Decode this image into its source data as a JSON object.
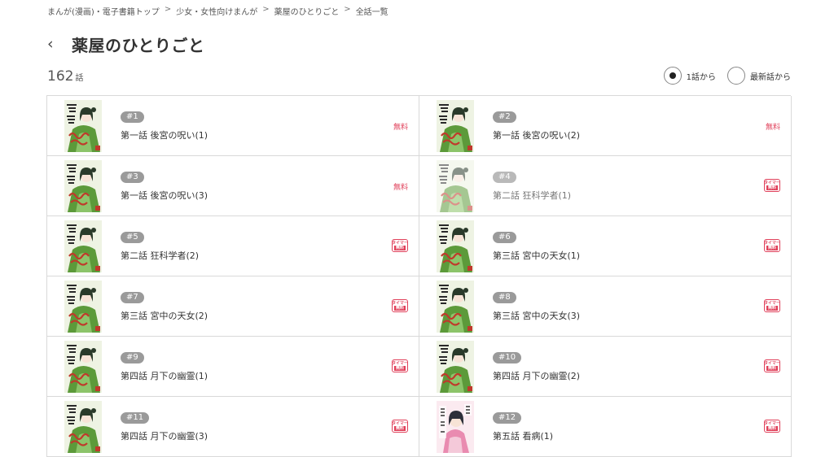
{
  "breadcrumb": [
    {
      "label": "まんが(漫画)・電子書籍トップ"
    },
    {
      "label": "少女・女性向けまんが"
    },
    {
      "label": "薬屋のひとりごと"
    },
    {
      "label": "全話一覧"
    }
  ],
  "breadcrumb_separator": ">",
  "header": {
    "back_icon": "‹",
    "title": "薬屋のひとりごと"
  },
  "count": {
    "value": "162",
    "unit": "話"
  },
  "sort": {
    "option1_label": "1話から",
    "option2_label": "最新話から",
    "selected": "option1"
  },
  "badges": {
    "free": "無料",
    "timer_top": "タイマー",
    "timer_bottom": "無料"
  },
  "colors": {
    "accent_red": "#e0405a",
    "badge_gray": "#9a9a9a",
    "border": "#d9d9d9"
  },
  "episodes": [
    {
      "num": "#1",
      "title": "第一話 後宮の呪い(1)",
      "badge": "free",
      "cover": "green",
      "read": false
    },
    {
      "num": "#2",
      "title": "第一話 後宮の呪い(2)",
      "badge": "free",
      "cover": "green",
      "read": false
    },
    {
      "num": "#3",
      "title": "第一話 後宮の呪い(3)",
      "badge": "free",
      "cover": "green",
      "read": false
    },
    {
      "num": "#4",
      "title": "第二話 狂科学者(1)",
      "badge": "timer",
      "cover": "green",
      "read": true
    },
    {
      "num": "#5",
      "title": "第二話 狂科学者(2)",
      "badge": "timer",
      "cover": "green",
      "read": false
    },
    {
      "num": "#6",
      "title": "第三話 宮中の天女(1)",
      "badge": "timer",
      "cover": "green",
      "read": false
    },
    {
      "num": "#7",
      "title": "第三話 宮中の天女(2)",
      "badge": "timer",
      "cover": "green",
      "read": false
    },
    {
      "num": "#8",
      "title": "第三話 宮中の天女(3)",
      "badge": "timer",
      "cover": "green",
      "read": false
    },
    {
      "num": "#9",
      "title": "第四話 月下の幽霊(1)",
      "badge": "timer",
      "cover": "green",
      "read": false
    },
    {
      "num": "#10",
      "title": "第四話 月下の幽霊(2)",
      "badge": "timer",
      "cover": "green",
      "read": false
    },
    {
      "num": "#11",
      "title": "第四話 月下の幽霊(3)",
      "badge": "timer",
      "cover": "green",
      "read": false
    },
    {
      "num": "#12",
      "title": "第五話 看病(1)",
      "badge": "timer",
      "cover": "pink",
      "read": false
    }
  ]
}
